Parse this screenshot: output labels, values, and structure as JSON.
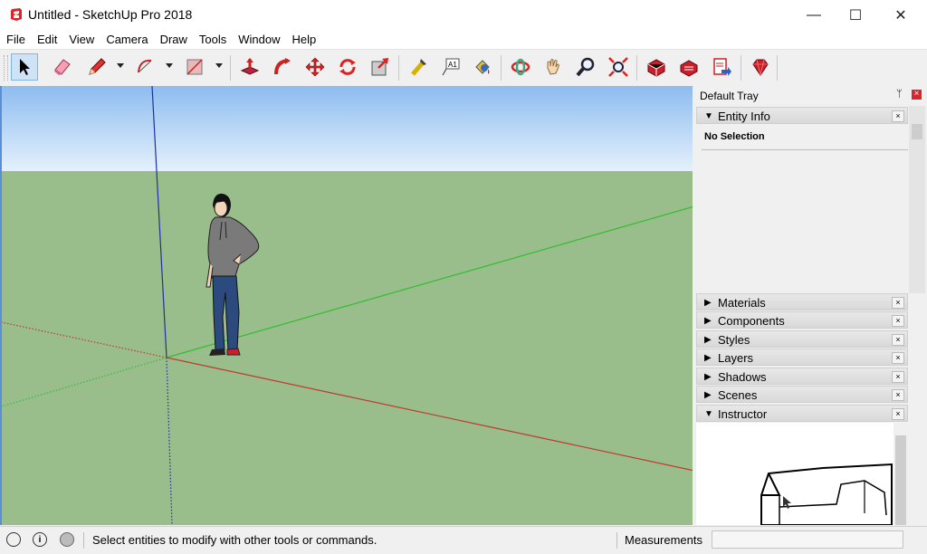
{
  "window": {
    "title": "Untitled - SketchUp Pro 2018",
    "minimize_glyph": "—",
    "maximize_glyph": "☐",
    "close_glyph": "✕"
  },
  "menu": [
    "File",
    "Edit",
    "View",
    "Camera",
    "Draw",
    "Tools",
    "Window",
    "Help"
  ],
  "toolbar": {
    "tools": [
      "select",
      "eraser",
      "pencil-line",
      "arc",
      "rectangle",
      "push-pull",
      "follow-me",
      "move",
      "rotate",
      "scale",
      "tape-measure",
      "text",
      "paint-bucket",
      "orbit",
      "pan",
      "zoom",
      "zoom-extents",
      "3d-warehouse",
      "extension-warehouse",
      "send-to-layout",
      "extension-manager"
    ],
    "text_tool_glyph": "A1",
    "active_tool": "select"
  },
  "tray": {
    "title": "Default Tray",
    "pin_glyph": "ᛘ",
    "close_glyph": "×",
    "panels": [
      {
        "label": "Entity Info",
        "expanded": true
      },
      {
        "label": "Materials",
        "expanded": false
      },
      {
        "label": "Components",
        "expanded": false
      },
      {
        "label": "Styles",
        "expanded": false
      },
      {
        "label": "Layers",
        "expanded": false
      },
      {
        "label": "Shadows",
        "expanded": false
      },
      {
        "label": "Scenes",
        "expanded": false
      },
      {
        "label": "Instructor",
        "expanded": true
      }
    ],
    "expanded_glyph": "▼",
    "collapsed_glyph": "▶",
    "entity_info": {
      "selection": "No Selection"
    }
  },
  "status": {
    "icons": [
      "geo-location-icon",
      "credits-icon",
      "user-icon"
    ],
    "icon_glyphs": [
      "",
      "i",
      ""
    ],
    "message": "Select entities to modify with other tools or commands.",
    "measurements_label": "Measurements",
    "measurements_value": ""
  },
  "colors": {
    "sky_top": "#8dbcef",
    "sky_bottom": "#e5f1fc",
    "ground": "#9abd8c",
    "axis_red": "#c0392b",
    "axis_green": "#2fbf2f",
    "axis_blue": "#2030a0"
  }
}
